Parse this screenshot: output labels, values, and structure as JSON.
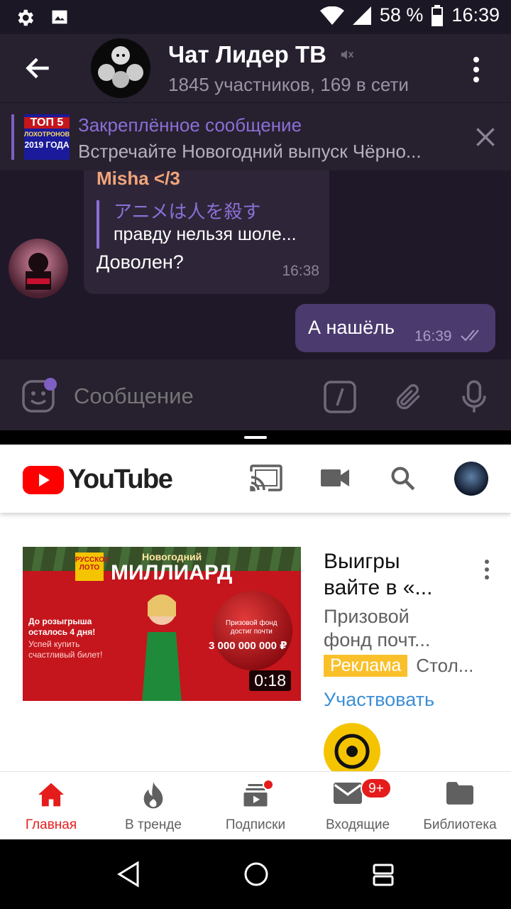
{
  "status_bar": {
    "icons": [
      "gear-icon",
      "image-icon",
      "wifi-icon",
      "signal-icon",
      "battery-icon"
    ],
    "battery": "58 %",
    "time": "16:39"
  },
  "telegram": {
    "chat_title": "Чат Лидер ТВ",
    "chat_subtitle": "1845 участников, 169 в сети",
    "pinned": {
      "title": "Закреплённое сообщение",
      "text": "Встречайте Новогодний выпуск Чёрно...",
      "thumb_lines": [
        "ТОП 5",
        "ЛОХОТРОНОВ",
        "2019 ГОДА"
      ]
    },
    "incoming": {
      "sender": "Misha </3",
      "quote_author": "アニメは人を殺す",
      "quote_text": "правду нельзя шоле...",
      "text": "Доволен?",
      "time": "16:38"
    },
    "outgoing": {
      "text": "А нашёль",
      "time": "16:39"
    },
    "input_placeholder": "Сообщение",
    "colors": {
      "accent": "#7e5fc2",
      "sender": "#f2a57a"
    }
  },
  "youtube": {
    "logo_text": "YouTube",
    "video": {
      "duration": "0:18",
      "thumb_brand": "РУССКОЕ ЛОТО",
      "thumb_top": "Новогодний",
      "thumb_headline": "МИЛЛИАРД",
      "thumb_left_1": "До розыгрыша\nосталось 4 дня!",
      "thumb_left_2": "Успей купить\nсчастливый билет!",
      "thumb_fund": "Призовой фонд\nдостиг почти",
      "thumb_amount": "3 000 000 000 ₽",
      "title": "Выигры\nвайте в «...",
      "description": "Призовой\nфонд почт...",
      "ad_label": "Реклама",
      "ad_source": "Стол...",
      "cta": "Участвовать"
    },
    "nav": [
      {
        "label": "Главная",
        "icon": "home-icon",
        "active": true
      },
      {
        "label": "В тренде",
        "icon": "flame-icon"
      },
      {
        "label": "Подписки",
        "icon": "subscriptions-icon"
      },
      {
        "label": "Входящие",
        "icon": "mail-icon",
        "badge": "9+"
      },
      {
        "label": "Библиотека",
        "icon": "folder-icon"
      }
    ],
    "colors": {
      "brand": "#ff0000",
      "ad": "#f9c02a",
      "link": "#3d8fd6"
    }
  },
  "android_nav": [
    "back-icon",
    "home-circle-icon",
    "recents-icon"
  ]
}
